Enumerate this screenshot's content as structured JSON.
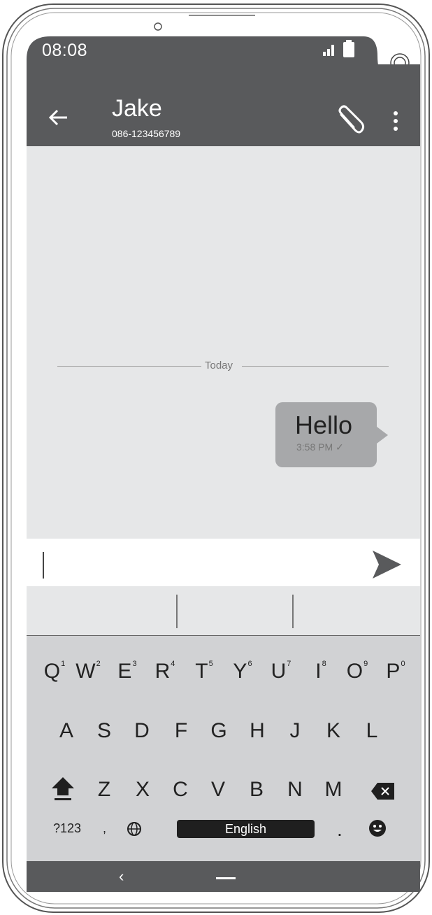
{
  "status_bar": {
    "time": "08:08"
  },
  "header": {
    "contact_name": "Jake",
    "contact_phone": "086-123456789"
  },
  "chat": {
    "divider_label": "Today",
    "messages": [
      {
        "text": "Hello",
        "time": "3:58 PM ✓"
      }
    ]
  },
  "composer": {
    "value": ""
  },
  "keyboard": {
    "row1": [
      {
        "k": "Q",
        "n": "1"
      },
      {
        "k": "W",
        "n": "2"
      },
      {
        "k": "E",
        "n": "3"
      },
      {
        "k": "R",
        "n": "4"
      },
      {
        "k": "T",
        "n": "5"
      },
      {
        "k": "Y",
        "n": "6"
      },
      {
        "k": "U",
        "n": "7"
      },
      {
        "k": "I",
        "n": "8"
      },
      {
        "k": "O",
        "n": "9"
      },
      {
        "k": "P",
        "n": "0"
      }
    ],
    "row2": [
      "A",
      "S",
      "D",
      "F",
      "G",
      "H",
      "J",
      "K",
      "L"
    ],
    "row3": [
      "Z",
      "X",
      "C",
      "V",
      "B",
      "N",
      "M"
    ],
    "bottom": {
      "symbols": "?123",
      "comma": ",",
      "space": "English",
      "period": "."
    }
  },
  "colors": {
    "header": "#595a5c",
    "chat_bg": "#e6e7e8",
    "bubble": "#a7a8aa",
    "keyboard": "#d1d2d4"
  },
  "icons": [
    "back-arrow-icon",
    "paperclip-icon",
    "more-vert-icon",
    "send-icon",
    "shift-icon",
    "backspace-icon",
    "globe-icon",
    "emoji-icon",
    "signal-icon",
    "battery-icon",
    "camera-icon"
  ]
}
